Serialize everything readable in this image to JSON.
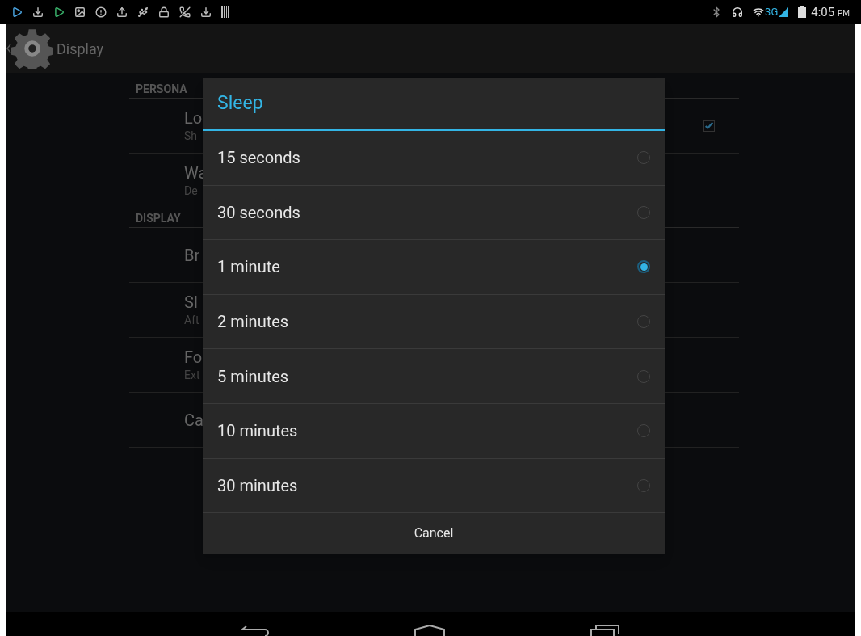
{
  "status_bar": {
    "network": "3G",
    "time": "4:05",
    "meridiem": "PM"
  },
  "action_bar": {
    "title": "Display"
  },
  "settings": [
    {
      "header": "PERSONA",
      "items": [
        {
          "title": "Lo",
          "summary": "Sh",
          "checked": true
        },
        {
          "title": "Wa",
          "summary": "De"
        }
      ]
    },
    {
      "header": "DISPLAY",
      "items": [
        {
          "title": "Br"
        },
        {
          "title": "Sl",
          "summary": "Aft"
        },
        {
          "title": "Fo",
          "summary": "Ext"
        },
        {
          "title": "Ca"
        }
      ]
    }
  ],
  "dialog": {
    "title": "Sleep",
    "options": [
      {
        "label": "15 seconds",
        "selected": false
      },
      {
        "label": "30 seconds",
        "selected": false
      },
      {
        "label": "1 minute",
        "selected": true
      },
      {
        "label": "2 minutes",
        "selected": false
      },
      {
        "label": "5 minutes",
        "selected": false
      },
      {
        "label": "10 minutes",
        "selected": false
      },
      {
        "label": "30 minutes",
        "selected": false
      }
    ],
    "cancel": "Cancel"
  }
}
